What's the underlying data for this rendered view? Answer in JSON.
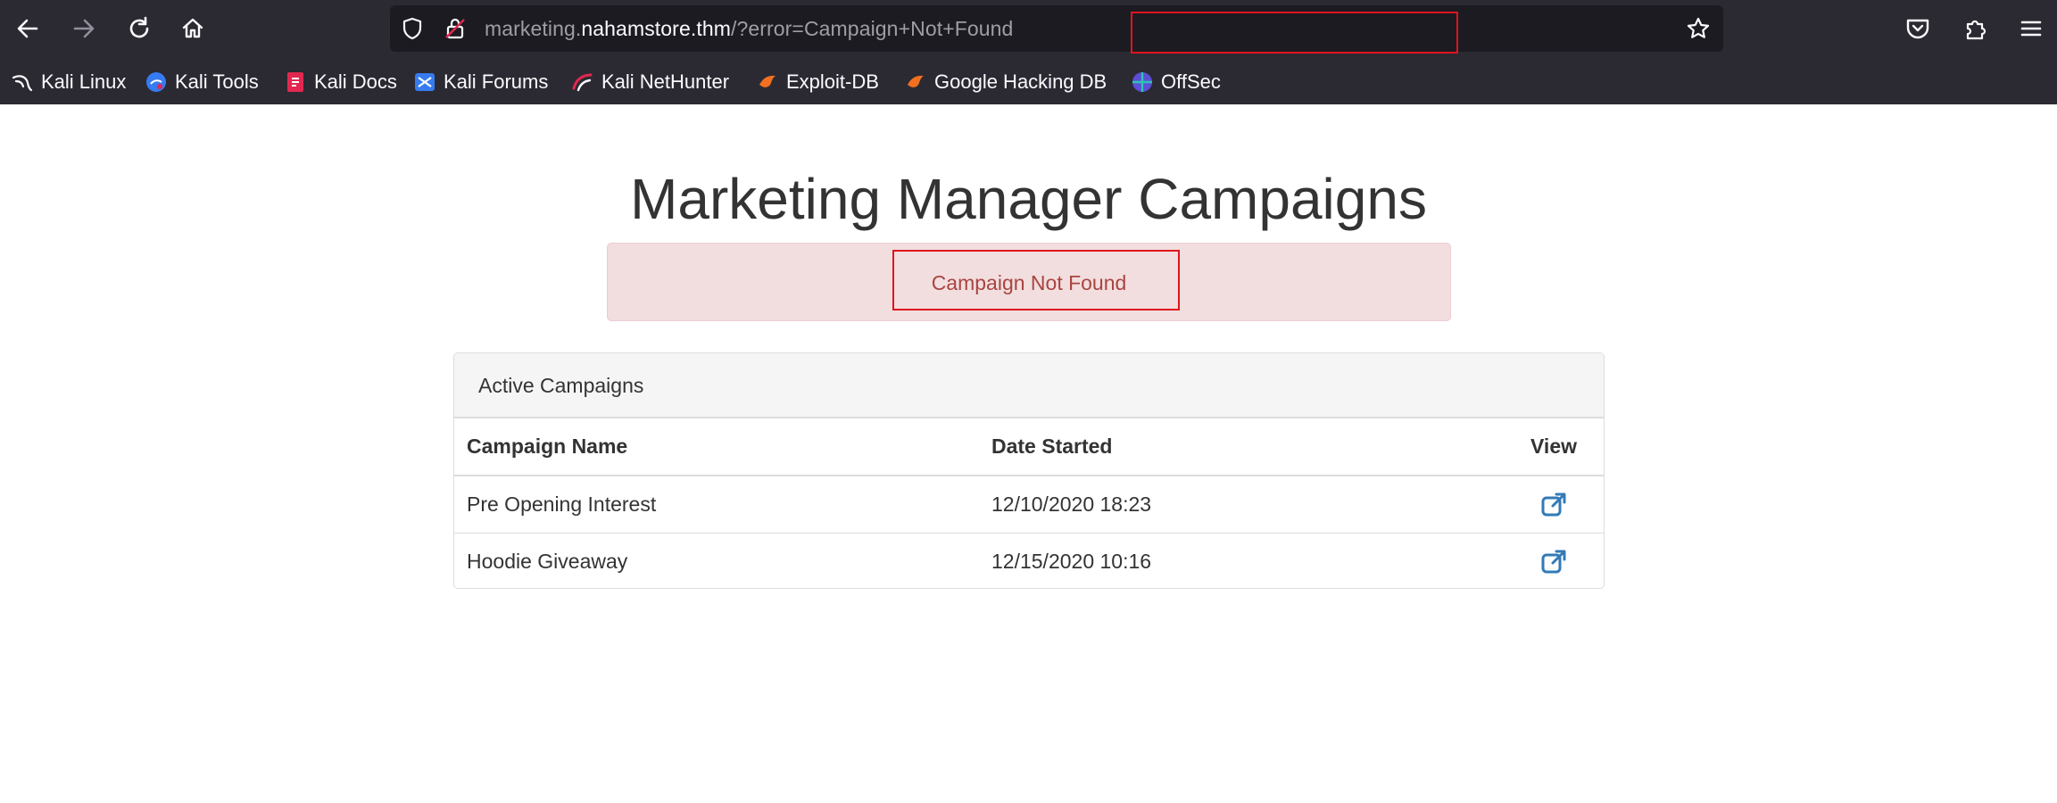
{
  "browser": {
    "url": {
      "subdomain": "marketing.",
      "domain": "nahamstore.thm",
      "path": "/?error=Campaign+Not+Found"
    },
    "bookmarks": [
      {
        "label": "Kali Linux",
        "icon": "kali-dragon-icon"
      },
      {
        "label": "Kali Tools",
        "icon": "kali-tools-icon"
      },
      {
        "label": "Kali Docs",
        "icon": "kali-docs-icon"
      },
      {
        "label": "Kali Forums",
        "icon": "kali-forums-icon"
      },
      {
        "label": "Kali NetHunter",
        "icon": "kali-nethunter-icon"
      },
      {
        "label": "Exploit-DB",
        "icon": "exploit-db-icon"
      },
      {
        "label": "Google Hacking DB",
        "icon": "google-hacking-db-icon"
      },
      {
        "label": "OffSec",
        "icon": "offsec-icon"
      }
    ]
  },
  "page": {
    "title": "Marketing Manager Campaigns",
    "alert": "Campaign Not Found",
    "panel_heading": "Active Campaigns",
    "table": {
      "headers": [
        "Campaign Name",
        "Date Started",
        "View"
      ],
      "rows": [
        {
          "name": "Pre Opening Interest",
          "date": "12/10/2020 18:23",
          "view_icon": "external-link-icon"
        },
        {
          "name": "Hoodie Giveaway",
          "date": "12/15/2020 10:16",
          "view_icon": "external-link-icon"
        }
      ]
    }
  },
  "colors": {
    "chrome_bg": "#2b2a33",
    "urlbar_bg": "#1c1b22",
    "alert_bg": "#f2dede",
    "alert_text": "#a94442",
    "link_blue": "#337ab7",
    "highlight_red": "#e0141e"
  }
}
